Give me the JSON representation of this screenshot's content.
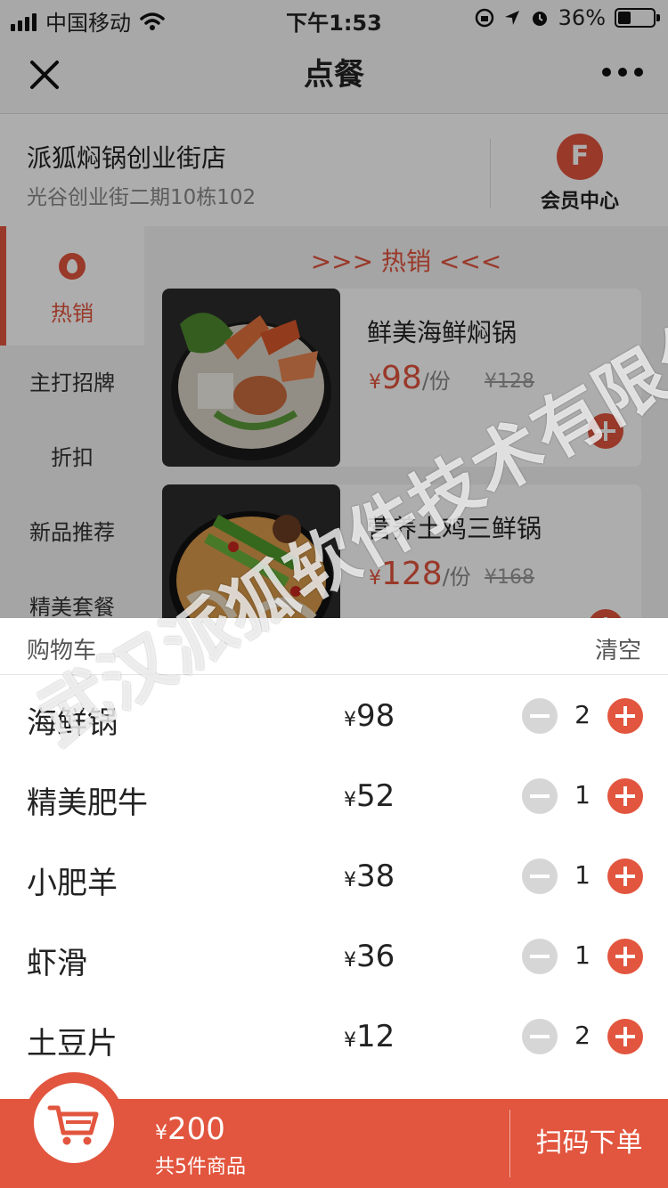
{
  "status_bar": {
    "carrier": "中国移动",
    "time": "下午1:53",
    "battery": "36%",
    "battery_level": 0.36
  },
  "nav": {
    "title": "点餐"
  },
  "store": {
    "name": "派狐焖锅创业街店",
    "address": "光谷创业街二期10栋102",
    "member_label": "会员中心"
  },
  "categories": [
    {
      "label": "热销"
    },
    {
      "label": "主打招牌"
    },
    {
      "label": "折扣"
    },
    {
      "label": "新品推荐"
    },
    {
      "label": "精美套餐"
    }
  ],
  "section_title": ">>> 热销 <<<",
  "dishes": [
    {
      "name": "鲜美海鲜焖锅",
      "currency": "¥",
      "price": "98",
      "unit": "/份",
      "original": "¥128"
    },
    {
      "name": "营养土鸡三鲜锅",
      "currency": "¥",
      "price": "128",
      "unit": "/份",
      "original": "¥168"
    }
  ],
  "cart": {
    "title": "购物车",
    "clear_label": "清空",
    "items": [
      {
        "name": "海鲜锅",
        "currency": "¥",
        "price": "98",
        "qty": "2"
      },
      {
        "name": "精美肥牛",
        "currency": "¥",
        "price": "52",
        "qty": "1"
      },
      {
        "name": "小肥羊",
        "currency": "¥",
        "price": "38",
        "qty": "1"
      },
      {
        "name": "虾滑",
        "currency": "¥",
        "price": "36",
        "qty": "1"
      },
      {
        "name": "土豆片",
        "currency": "¥",
        "price": "12",
        "qty": "2"
      }
    ]
  },
  "footer": {
    "currency": "¥",
    "total": "200",
    "count_text": "共5件商品",
    "order_label": "扫码下单"
  },
  "watermark": "武汉派狐软件技术有限公司",
  "colors": {
    "accent": "#e2553e"
  }
}
